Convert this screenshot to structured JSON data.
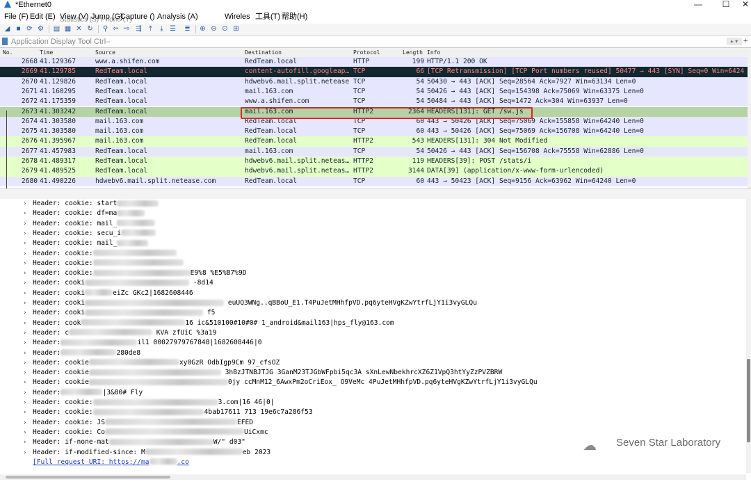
{
  "window": {
    "title": "*Ethernet0",
    "controls": {
      "minimize": "—",
      "maximize": "☐",
      "close": "✕"
    }
  },
  "menu": {
    "items": [
      "File (F)",
      "Edit (E)",
      "View (V)",
      "Jump (G)",
      "Capture ()",
      "Analysis (A)",
      "Wireles",
      "工具(T)",
      "帮助(H)"
    ],
    "overlay_text": "Statistics (S) Phone (Y)"
  },
  "filter": {
    "placeholder": "Application Display Tool Ctrl–"
  },
  "packet_list": {
    "columns": [
      "No.",
      "Time",
      "Source",
      "Destination",
      "Protocol",
      "Length",
      "Info"
    ],
    "rows": [
      {
        "no": "2668",
        "time": "41.129367",
        "src": "www.a.shifen.com",
        "dst": "RedTeam.local",
        "proto": "HTTP",
        "len": "199",
        "info": "HTTP/1.1 200 OK",
        "bg": "#e7e6ff",
        "fg": "#12272e"
      },
      {
        "no": "2669",
        "time": "41.129785",
        "src": "RedTeam.local",
        "dst": "content-autofill.googleap…",
        "proto": "TCP",
        "len": "66",
        "info": "[TCP Retransmission] [TCP Port numbers reused] 50477 → 443 [SYN] Seq=0 Win=6424",
        "bg": "#12272e",
        "fg": "#f78787"
      },
      {
        "no": "2670",
        "time": "41.129826",
        "src": "RedTeam.local",
        "dst": "hdwebv6.mail.split.netease…",
        "proto": "TCP",
        "len": "54",
        "info": "50430 → 443 [ACK] Seq=28564 Ack=7927 Win=63134 Len=0",
        "bg": "#e7e6ff",
        "fg": "#12272e"
      },
      {
        "no": "2671",
        "time": "41.160295",
        "src": "RedTeam.local",
        "dst": "mail.163.com",
        "proto": "TCP",
        "len": "54",
        "info": "50426 → 443 [ACK] Seq=154398 Ack=75069 Win=63375 Len=0",
        "bg": "#e7e6ff",
        "fg": "#12272e"
      },
      {
        "no": "2672",
        "time": "41.175359",
        "src": "RedTeam.local",
        "dst": "www.a.shifen.com",
        "proto": "TCP",
        "len": "54",
        "info": "50484 → 443 [ACK] Seq=1472 Ack=304 Win=63937 Len=0",
        "bg": "#e7e6ff",
        "fg": "#12272e"
      },
      {
        "no": "2673",
        "time": "41.303242",
        "src": "RedTeam.local",
        "dst": "mail.163.com",
        "proto": "HTTP2",
        "len": "2364",
        "info": "HEADERS[131]: GET /sw.js",
        "bg": "#b5d3a3",
        "fg": "#12272e"
      },
      {
        "no": "2674",
        "time": "41.303580",
        "src": "mail.163.com",
        "dst": "RedTeam.local",
        "proto": "TCP",
        "len": "60",
        "info": "443 → 50426 [ACK] Seq=75069 Ack=155858 Win=64240 Len=0",
        "bg": "#e7e6ff",
        "fg": "#12272e"
      },
      {
        "no": "2675",
        "time": "41.303580",
        "src": "mail.163.com",
        "dst": "RedTeam.local",
        "proto": "TCP",
        "len": "60",
        "info": "443 → 50426 [ACK] Seq=75069 Ack=156708 Win=64240 Len=0",
        "bg": "#e7e6ff",
        "fg": "#12272e"
      },
      {
        "no": "2676",
        "time": "41.395967",
        "src": "mail.163.com",
        "dst": "RedTeam.local",
        "proto": "HTTP2",
        "len": "543",
        "info": "HEADERS[131]: 304 Not Modified",
        "bg": "#e4ffc7",
        "fg": "#12272e"
      },
      {
        "no": "2677",
        "time": "41.457983",
        "src": "RedTeam.local",
        "dst": "mail.163.com",
        "proto": "TCP",
        "len": "54",
        "info": "50426 → 443 [ACK] Seq=156708 Ack=75558 Win=62886 Len=0",
        "bg": "#e7e6ff",
        "fg": "#12272e"
      },
      {
        "no": "2678",
        "time": "41.489317",
        "src": "RedTeam.local",
        "dst": "hdwebv6.mail.split.neteas…",
        "proto": "HTTP2",
        "len": "119",
        "info": "HEADERS[39]: POST /stats/i",
        "bg": "#e4ffc7",
        "fg": "#12272e"
      },
      {
        "no": "2679",
        "time": "41.489525",
        "src": "RedTeam.local",
        "dst": "hdwebv6.mail.split.neteas…",
        "proto": "HTTP2",
        "len": "3144",
        "info": "DATA[39] (application/x-www-form-urlencoded)",
        "bg": "#e4ffc7",
        "fg": "#12272e"
      },
      {
        "no": "2680",
        "time": "41.490226",
        "src": "hdwebv6.mail.split.netease.com",
        "dst": "RedTeam.local",
        "proto": "TCP",
        "len": "60",
        "info": "443 → 50423 [ACK] Seq=9156 Ack=63962 Win=64240 Len=0",
        "bg": "#e7e6ff",
        "fg": "#12272e"
      }
    ]
  },
  "detail": {
    "lines": [
      {
        "pre": "Header: cookie: start",
        "post": ""
      },
      {
        "pre": "Header: cookie: df=ma",
        "post": ""
      },
      {
        "pre": "Header: cookie: mail_",
        "post": ""
      },
      {
        "pre": "Header: cookie: secu_i",
        "post": ""
      },
      {
        "pre": "Header: cookie: mail_",
        "post": ""
      },
      {
        "pre": "Header: cookie:",
        "post": ""
      },
      {
        "pre": "Header: cookie:",
        "post": ""
      },
      {
        "pre": "Header: cookie:",
        "post": "E9%8            %E5%B7%9D"
      },
      {
        "pre": "Header: cooki",
        "post": "                          -8d14"
      },
      {
        "pre": "Header: cooki",
        "post": "eiZc          GKc2|1682608446"
      },
      {
        "pre": "Header: cooki",
        "post": "                                                                euUQ3WNg..qBBoU_E1.T4PuJetMHhfpVD.pq6yteHVgKZwYtrfLjY1i3vyGLQu"
      },
      {
        "pre": "Header: cooki",
        "post": "                  f5"
      },
      {
        "pre": "Header: cook",
        "post": "16                             ic&510100#10#0#            1_android&mail163|hps_fly@163.com"
      },
      {
        "pre": "Header: c",
        "post": "  KVA                   zfUiC       %3a19"
      },
      {
        "pre": "Header:",
        "post": "il1                              00027979767848|1682608446|0"
      },
      {
        "pre": "Header:",
        "post": "280de8"
      },
      {
        "pre": "Header: cookie",
        "post": "xy0GzR                   OdbIgp9Cm                                     97_cfsOZ"
      },
      {
        "pre": "Header: cookie",
        "post": "                   3hBzJTNBJTJG             3GanM23TJGbWFpbi5qc3A          sXnLewNbekhrcXZ6Z1VpQ3htYyZzPVZBRW"
      },
      {
        "pre": "Header: cookie",
        "post": "0jy         ccMnM12_6AwxPm2oCriEox_            O9VeMc                    4PuJetMHhfpVD.pq6yteHVgKZwYtrfLjY1i3vyGLQu"
      },
      {
        "pre": "Header:",
        "post": "|3&80#     Fly"
      },
      {
        "pre": "Header: cookie:",
        "post": "3.com|16          46|0|                                           "
      },
      {
        "pre": "Header: cookie:",
        "post": "4bab17611          713            19e6c7a286f53"
      },
      {
        "pre": "Header: cookie: JS",
        "post": "EFED"
      },
      {
        "pre": "Header: cookie: Co",
        "post": "UiCxmc"
      },
      {
        "pre": "Header: if-none-mat",
        "post": "W/\"       d03\""
      },
      {
        "pre": "Header: if-modified-since: M",
        "post": "eb 2023"
      }
    ],
    "link": {
      "prefix": "[Full request URI: https://ma",
      "suffix": ".co"
    }
  },
  "watermark": {
    "text": "Seven Star Laboratory"
  },
  "colors": {
    "tcp_row": "#e7e6ff",
    "http2_row": "#e4ffc7",
    "selected_row": "#b5d3a3",
    "bad_row": "#12272e",
    "annotation_box": "#d9242a"
  }
}
